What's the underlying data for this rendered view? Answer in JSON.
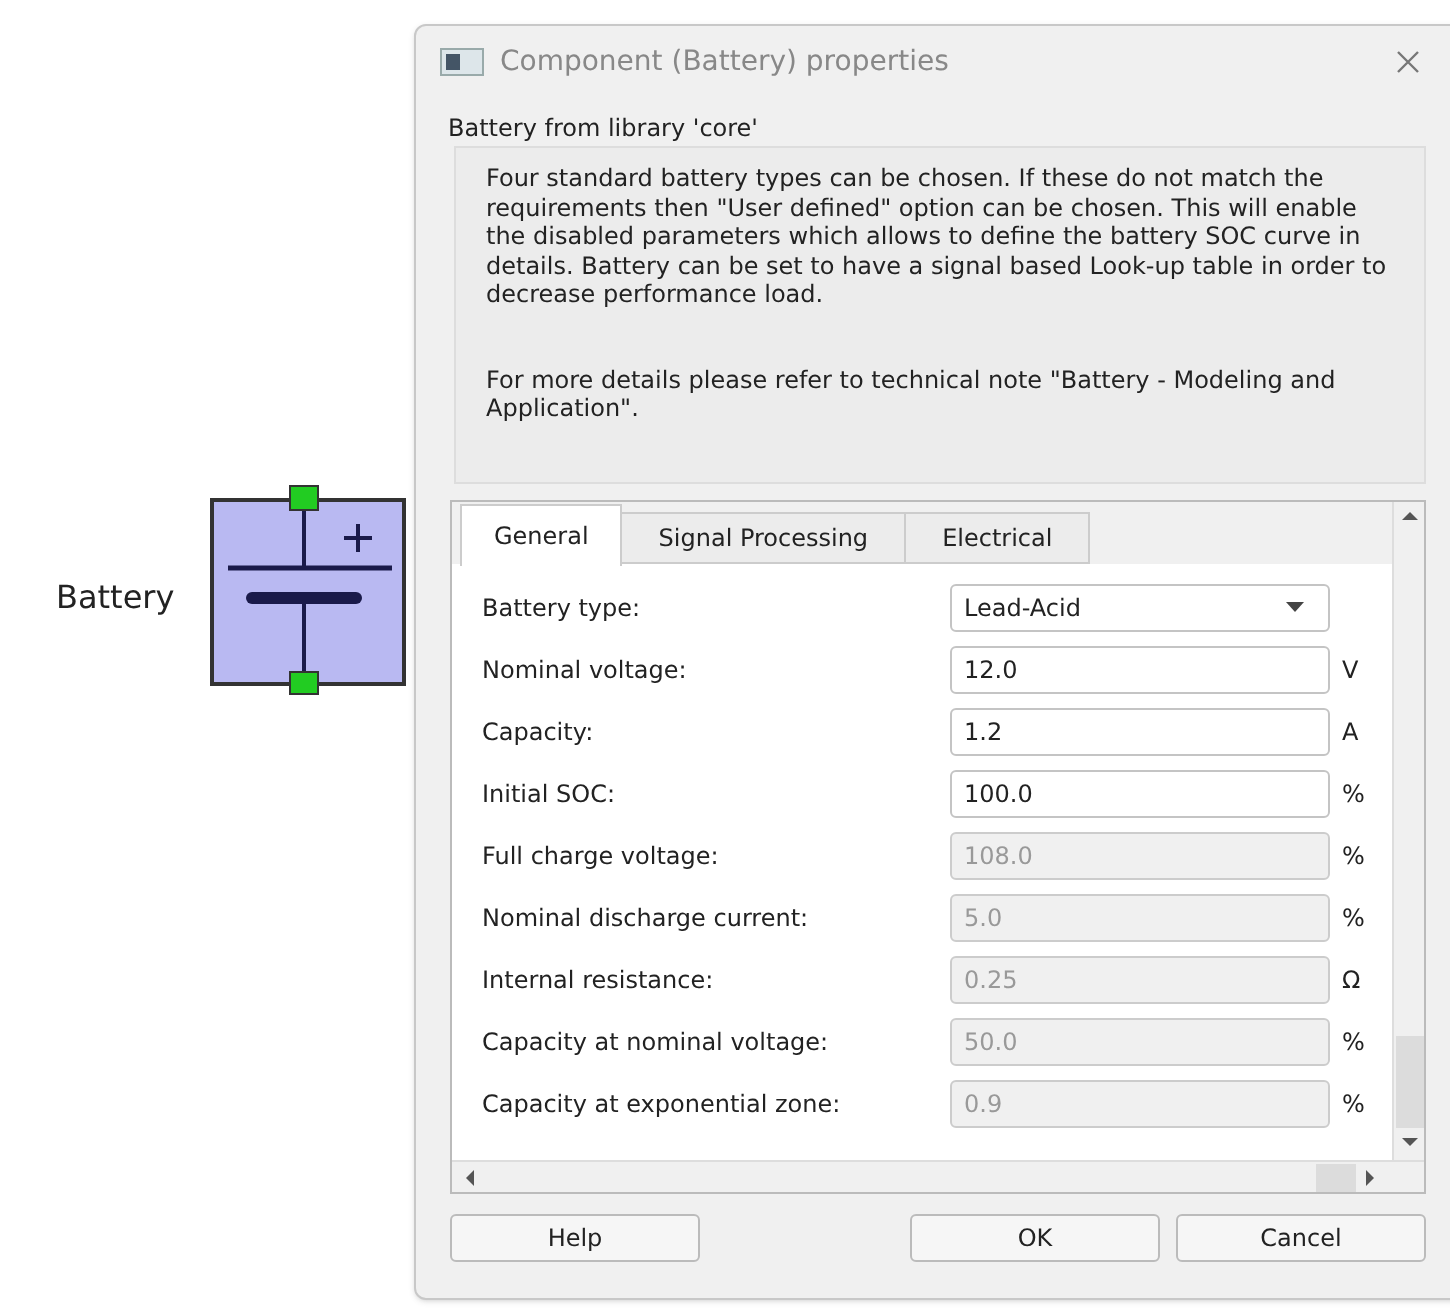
{
  "canvas": {
    "component_label": "Battery"
  },
  "window": {
    "title": "Component (Battery) properties",
    "subtitle": "Battery from library 'core'"
  },
  "description": {
    "paragraph": "Four standard battery types can be chosen. If these do not match the requirements then \"User defined\" option can be chosen. This will enable the disabled parameters which allows to define the battery SOC curve in details. Battery can be set to have a signal based Look-up table in order to decrease performance load.",
    "note": "For more details please refer to technical note \"Battery - Modeling and Application\"."
  },
  "tabs": [
    {
      "label": "General",
      "selected": true
    },
    {
      "label": "Signal Processing",
      "selected": false
    },
    {
      "label": "Electrical",
      "selected": false
    }
  ],
  "parameters": [
    {
      "label": "Battery type:",
      "kind": "dropdown",
      "value": "Lead-Acid",
      "disabled": false
    },
    {
      "label": "Nominal voltage:",
      "kind": "text",
      "value": "12.0",
      "unit": "V",
      "disabled": false
    },
    {
      "label": "Capacity:",
      "kind": "text",
      "value": "1.2",
      "unit": "A",
      "disabled": false
    },
    {
      "label": "Initial SOC:",
      "kind": "text",
      "value": "100.0",
      "unit": "%",
      "disabled": false
    },
    {
      "label": "Full charge voltage:",
      "kind": "text",
      "value": "108.0",
      "unit": "%",
      "disabled": true
    },
    {
      "label": "Nominal discharge current:",
      "kind": "text",
      "value": "5.0",
      "unit": "%",
      "disabled": true
    },
    {
      "label": "Internal resistance:",
      "kind": "text",
      "value": "0.25",
      "unit": "Ω",
      "disabled": true
    },
    {
      "label": "Capacity at nominal voltage:",
      "kind": "text",
      "value": "50.0",
      "unit": "%",
      "disabled": true
    },
    {
      "label": "Capacity at exponential zone:",
      "kind": "text",
      "value": "0.9",
      "unit": "%",
      "disabled": true
    }
  ],
  "buttons": [
    {
      "label": "Help",
      "kind": "help"
    },
    {
      "label": "OK",
      "kind": "ok"
    },
    {
      "label": "Cancel",
      "kind": "cancel"
    }
  ]
}
